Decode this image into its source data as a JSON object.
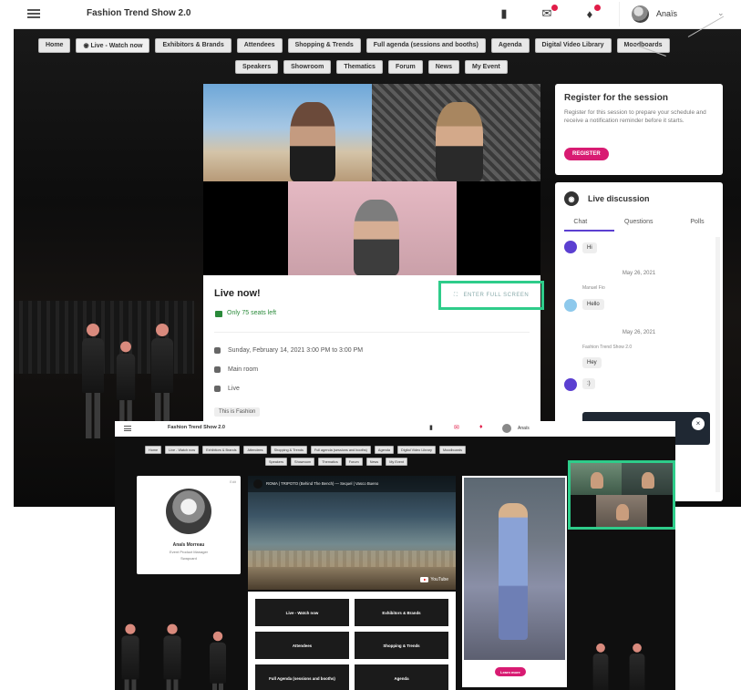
{
  "main": {
    "app_title": "Fashion Trend Show 2.0",
    "user_name": "Anaïs",
    "nav_row1": [
      "Home",
      "Live - Watch now",
      "Exhibitors & Brands",
      "Attendees",
      "Shopping & Trends",
      "Full agenda (sessions and booths)",
      "Agenda",
      "Digital Video Library",
      "Moodboards"
    ],
    "nav_row2": [
      "Speakers",
      "Showroom",
      "Thematics",
      "Forum",
      "News",
      "My Event"
    ],
    "session": {
      "live_label": "Live now!",
      "fullscreen_label": "ENTER FULL SCREEN",
      "seats_label": "Only 75 seats left",
      "date": "Sunday, February 14, 2021 3:00 PM to 3:00 PM",
      "location": "Main room",
      "format": "Live",
      "tag": "This is Fashion"
    },
    "register": {
      "title": "Register for the session",
      "body": "Register for this session to prepare your schedule and receive a notification reminder before it starts.",
      "button": "REGISTER"
    },
    "chat": {
      "title": "Live discussion",
      "tabs": [
        "Chat",
        "Questions",
        "Polls"
      ],
      "messages": [
        {
          "author": "",
          "text": "Hi",
          "time": ""
        },
        {
          "date": "May 26, 2021"
        },
        {
          "author": "Manuel Fio",
          "text": "Hello",
          "time": ""
        },
        {
          "date": "May 26, 2021"
        },
        {
          "author": "Fashion Trend Show 2.0",
          "text": "Hey",
          "time": ""
        },
        {
          "author": "",
          "text": ":)",
          "time": ""
        }
      ]
    }
  },
  "overlay": {
    "app_title": "Fashion Trend Show 2.0",
    "user_name": "Anaïs",
    "nav_row1": [
      "Home",
      "Live - Watch now",
      "Exhibitors & Brands",
      "Attendees",
      "Shopping & Trends",
      "Full agenda (sessions and booths)",
      "Agenda",
      "Digital Video Library",
      "Moodboards"
    ],
    "nav_row2": [
      "Speakers",
      "Showroom",
      "Thematics",
      "Forum",
      "News",
      "My Event"
    ],
    "profile": {
      "name": "Anaïs Morreau",
      "role": "Event Product Manager",
      "status": "Swapcard",
      "edit": "Edit"
    },
    "video": {
      "title": "ROMA | TRIPOTO (Behind The Bench) — Sequel | Vasco Bueno",
      "platform": "YouTube"
    },
    "tiles": [
      "Live - Watch now",
      "Exhibitors & Brands",
      "Attendees",
      "Shopping & Trends",
      "Full Agenda (sessions and booths)",
      "Agenda"
    ],
    "fashion_button": "Learn more"
  },
  "colors": {
    "accent_green": "#2ecc8a",
    "brand_pink": "#d81b72",
    "chat_purple": "#5b3fd1"
  }
}
